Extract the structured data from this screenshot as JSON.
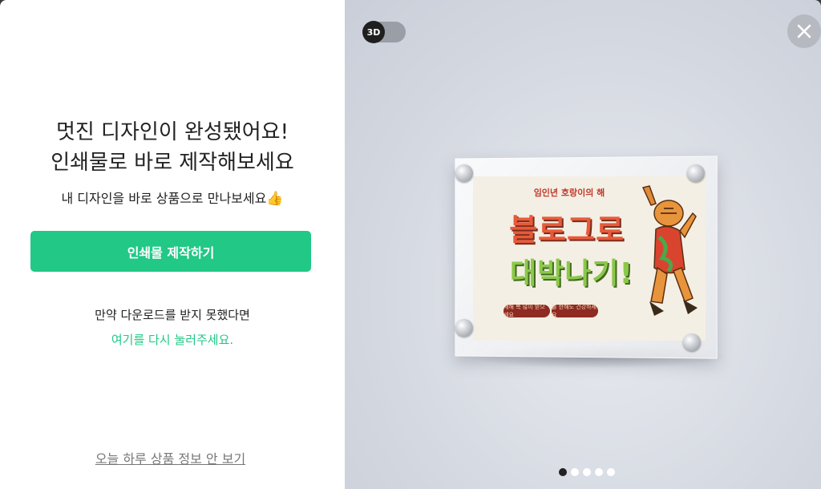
{
  "left_panel": {
    "headline_line1": "멋진 디자인이 완성됐어요!",
    "headline_line2": "인쇄물로 바로 제작해보세요",
    "subtitle": "내 디자인을 바로 상품으로 만나보세요",
    "subtitle_emoji": "👍",
    "cta_label": "인쇄물 제작하기",
    "download_fail_msg": "만약 다운로드를 받지 못했다면",
    "retry_link": "여기를 다시 눌러주세요.",
    "hide_today_link": "오늘 하루 상품 정보 안 보기"
  },
  "preview": {
    "toggle_label": "3D",
    "close_icon": "close-icon",
    "carousel": {
      "count": 5,
      "active_index": 0
    },
    "print": {
      "year_text": "임인년 호랑이의 해",
      "line1": "블로그로",
      "line2": "대박나기!",
      "tag1": "새해 복 많이 받으세요",
      "tag2": "올 한해도 건강하세요"
    }
  },
  "colors": {
    "accent": "#22c886",
    "text_dark": "#222222",
    "muted": "#777777"
  }
}
